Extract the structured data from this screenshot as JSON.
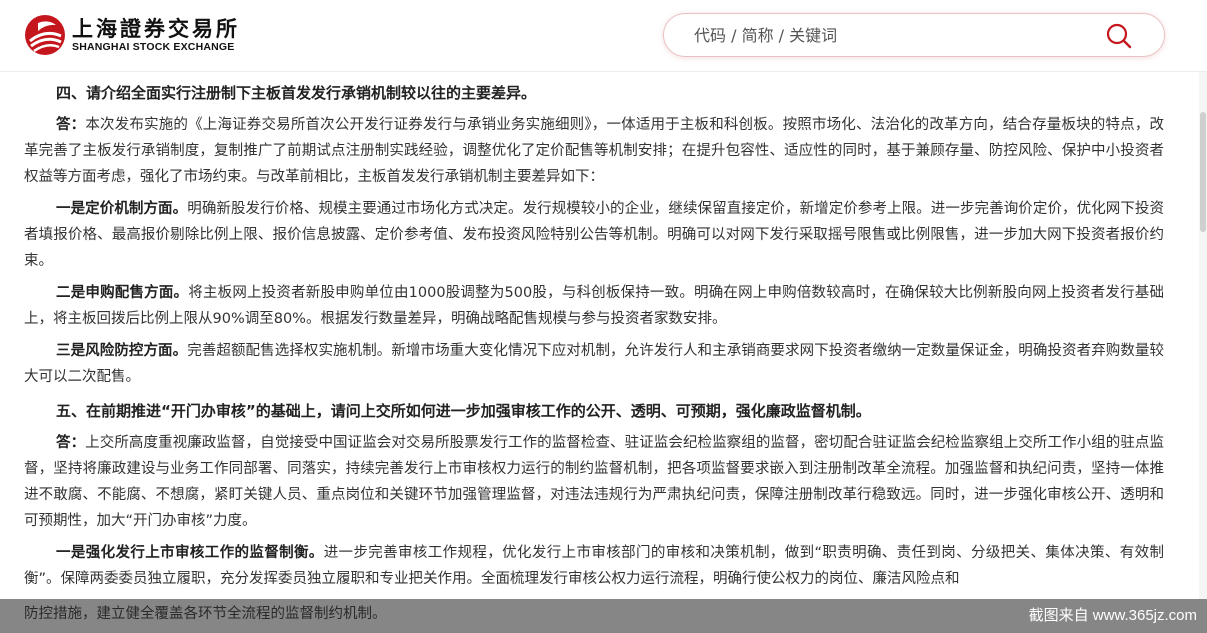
{
  "header": {
    "logo_cn": "上海證券交易所",
    "logo_en": "SHANGHAI STOCK EXCHANGE",
    "logo_color": "#c4161c"
  },
  "search": {
    "placeholder": "代码 / 简称 / 关键词",
    "value": "",
    "icon": "search-icon",
    "accent": "#c4161c"
  },
  "article": {
    "q4": "四、请介绍全面实行注册制下主板首发发行承销机制较以往的主要差异。",
    "q4_answer_lead": "答：",
    "q4_answer": "本次发布实施的《上海证券交易所首次公开发行证券发行与承销业务实施细则》，一体适用于主板和科创板。按照市场化、法治化的改革方向，结合存量板块的特点，改革完善了主板发行承销制度，复制推广了前期试点注册制实践经验，调整优化了定价配售等机制安排；在提升包容性、适应性的同时，基于兼顾存量、防控风险、保护中小投资者权益等方面考虑，强化了市场约束。与改革前相比，主板首发发行承销机制主要差异如下：",
    "p1_lead": "一是定价机制方面。",
    "p1": "明确新股发行价格、规模主要通过市场化方式决定。发行规模较小的企业，继续保留直接定价，新增定价参考上限。进一步完善询价定价，优化网下投资者填报价格、最高报价剔除比例上限、报价信息披露、定价参考值、发布投资风险特别公告等机制。明确可以对网下发行采取摇号限售或比例限售，进一步加大网下投资者报价约束。",
    "p2_lead": "二是申购配售方面。",
    "p2": "将主板网上投资者新股申购单位由1000股调整为500股，与科创板保持一致。明确在网上申购倍数较高时，在确保较大比例新股向网上投资者发行基础上，将主板回拨后比例上限从90%调至80%。根据发行数量差异，明确战略配售规模与参与投资者家数安排。",
    "p3_lead": "三是风险防控方面。",
    "p3": "完善超额配售选择权实施机制。新增市场重大变化情况下应对机制，允许发行人和主承销商要求网下投资者缴纳一定数量保证金，明确投资者弃购数量较大可以二次配售。",
    "q5": "五、在前期推进“开门办审核”的基础上，请问上交所如何进一步加强审核工作的公开、透明、可预期，强化廉政监督机制。",
    "q5_answer_lead": "答：",
    "q5_answer": "上交所高度重视廉政监督，自觉接受中国证监会对交易所股票发行工作的监督检查、驻证监会纪检监察组的监督，密切配合驻证监会纪检监察组上交所工作小组的驻点监督，坚持将廉政建设与业务工作同部署、同落实，持续完善发行上市审核权力运行的制约监督机制，把各项监督要求嵌入到注册制改革全流程。加强监督和执纪问责，坚持一体推进不敢腐、不能腐、不想腐，紧盯关键人员、重点岗位和关键环节加强管理监督，对违法违规行为严肃执纪问责，保障注册制改革行稳致远。同时，进一步强化审核公开、透明和可预期性，加大“开门办审核”力度。",
    "p4_lead": "一是强化发行上市审核工作的监督制衡。",
    "p4": "进一步完善审核工作规程，优化发行上市审核部门的审核和决策机制，做到“职责明确、责任到岗、分级把关、集体决策、有效制衡”。保障两委委员独立履职，充分发挥委员独立履职和专业把关作用。全面梳理发行审核公权力运行流程，明确行使公权力的岗位、廉洁风险点和",
    "p4_last_line": "防控措施，建立健全覆盖各环节全流程的监督制约机制。"
  },
  "overlay": {
    "watermark": "截图来自 www.365jz.com"
  }
}
